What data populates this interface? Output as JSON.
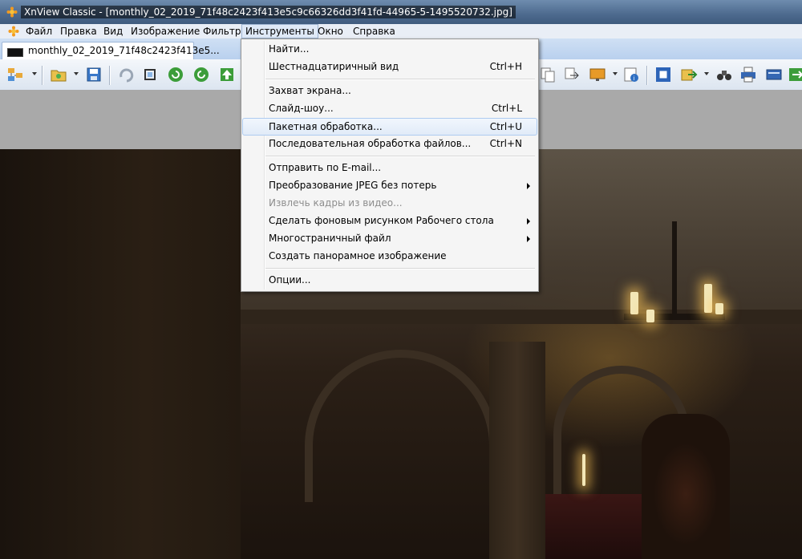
{
  "window": {
    "title": "XnView Classic - [monthly_02_2019_71f48c2423f413e5c9c66326dd3f41fd-44965-5-1495520732.jpg]"
  },
  "menubar": {
    "items": [
      "Файл",
      "Правка",
      "Вид",
      "Изображение",
      "Фильтр",
      "Инструменты",
      "Окно",
      "Справка"
    ],
    "active": "Инструменты"
  },
  "tab": {
    "label": "monthly_02_2019_71f48c2423f413e5..."
  },
  "tools_menu": {
    "items": [
      {
        "label": "Найти...",
        "shortcut": ""
      },
      {
        "label": "Шестнадцатиричный вид",
        "shortcut": "Ctrl+H"
      },
      {
        "label": "Захват экрана...",
        "shortcut": ""
      },
      {
        "label": "Слайд-шоу...",
        "shortcut": "Ctrl+L"
      },
      {
        "label": "Пакетная обработка...",
        "shortcut": "Ctrl+U",
        "highlighted": true
      },
      {
        "label": "Последовательная обработка файлов...",
        "shortcut": "Ctrl+N"
      },
      {
        "label": "Отправить по E-mail...",
        "shortcut": ""
      },
      {
        "label": "Преобразование JPEG без потерь",
        "shortcut": "",
        "submenu": true
      },
      {
        "label": "Извлечь кадры из видео...",
        "shortcut": "",
        "disabled": true
      },
      {
        "label": "Сделать фоновым рисунком Рабочего стола",
        "shortcut": "",
        "submenu": true
      },
      {
        "label": "Многостраничный файл",
        "shortcut": "",
        "submenu": true
      },
      {
        "label": "Создать панорамное изображение",
        "shortcut": ""
      },
      {
        "label": "Опции...",
        "shortcut": ""
      }
    ]
  },
  "icons": {
    "app": "xnview-flower-icon",
    "toolbar": [
      "browser-icon",
      "open-folder-icon",
      "save-icon",
      "rotate-left-icon",
      "crop-icon",
      "refresh-icon",
      "refresh-2-icon",
      "up-icon",
      "copy-icon",
      "move-icon",
      "desktop-icon",
      "info-icon",
      "fullscreen-icon",
      "export-icon",
      "binoculars-icon",
      "print-icon",
      "scanner-icon",
      "exit-icon"
    ]
  },
  "colors": {
    "menu_highlight": "#e1ebf8",
    "menu_bg": "#f5f5f5",
    "titlebar": "#4d6a8e"
  }
}
